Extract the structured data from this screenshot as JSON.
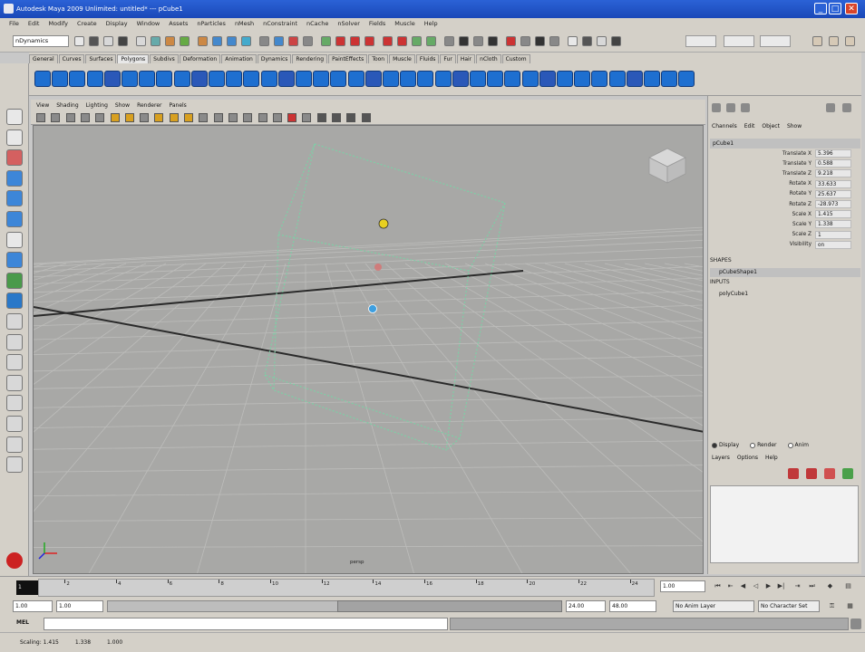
{
  "window": {
    "title": "Autodesk Maya 2009 Unlimited: untitled*   ---   pCube1",
    "minimize": "_",
    "maximize": "□",
    "close": "✕"
  },
  "menubar": {
    "items": [
      "File",
      "Edit",
      "Modify",
      "Create",
      "Display",
      "Window",
      "Assets",
      "nParticles",
      "nMesh",
      "nConstraint",
      "nCache",
      "nSolver",
      "Fields",
      "Muscle",
      "Help"
    ]
  },
  "statusline": {
    "mode": "nDynamics"
  },
  "shelf": {
    "tabs": [
      "General",
      "Curves",
      "Surfaces",
      "Polygons",
      "Subdivs",
      "Deformation",
      "Animation",
      "Dynamics",
      "Rendering",
      "PaintEffects",
      "Toon",
      "Muscle",
      "Fluids",
      "Fur",
      "Hair",
      "nCloth",
      "Custom"
    ],
    "active_tab": "Polygons"
  },
  "panel": {
    "menus": [
      "View",
      "Shading",
      "Lighting",
      "Show",
      "Renderer",
      "Panels"
    ],
    "camera_label": "persp"
  },
  "channelbox": {
    "header_menus": [
      "Channels",
      "Edit",
      "Object",
      "Show"
    ],
    "object_name": "pCube1",
    "attributes": [
      {
        "label": "Translate X",
        "value": "5.396"
      },
      {
        "label": "Translate Y",
        "value": "0.588"
      },
      {
        "label": "Translate Z",
        "value": "9.218"
      },
      {
        "label": "Rotate X",
        "value": "33.633"
      },
      {
        "label": "Rotate Y",
        "value": "25.637"
      },
      {
        "label": "Rotate Z",
        "value": "-28.973"
      },
      {
        "label": "Scale X",
        "value": "1.415"
      },
      {
        "label": "Scale Y",
        "value": "1.338"
      },
      {
        "label": "Scale Z",
        "value": "1"
      },
      {
        "label": "Visibility",
        "value": "on"
      }
    ],
    "shapes_label": "SHAPES",
    "shape_item": "pCubeShape1",
    "inputs_label": "INPUTS",
    "input_item": "polyCube1"
  },
  "layers": {
    "radios": [
      "Display",
      "Render",
      "Anim"
    ],
    "menus": [
      "Layers",
      "Options",
      "Help"
    ]
  },
  "timeline": {
    "ticks": [
      "2",
      "4",
      "6",
      "8",
      "10",
      "12",
      "14",
      "16",
      "18",
      "20",
      "22",
      "24"
    ],
    "current_frame_box": "1",
    "current_frame_field": "1.00"
  },
  "range": {
    "start_time": "1.00",
    "playback_start": "1.00",
    "playback_end": "24.00",
    "end_time": "48.00",
    "anim_layer": "No Anim Layer",
    "character_set": "No Character Set"
  },
  "cmdline": {
    "label": "MEL"
  },
  "helpline": {
    "items": [
      "Scaling: 1.415",
      "1.338",
      "1.000"
    ]
  },
  "colors": {
    "viewport_bg": "#a8a8a6",
    "grid_line": "#bdbdbb",
    "axis_line": "#2a2a2a",
    "cube_wire": "#7ecfa6",
    "titlebar": "#1a48b8",
    "ui_gray": "#d4d0c8",
    "shelf_icon_blue": "#1e6fd0"
  }
}
